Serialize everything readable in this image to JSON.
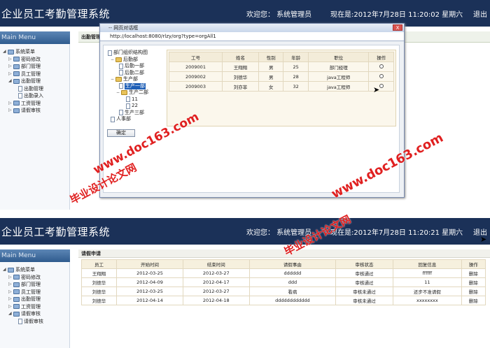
{
  "header": {
    "title": "企业员工考勤管理系统",
    "welcome": "欢迎您：  系统管理员",
    "time_top": "现在是:2012年7月28日  11:20:02 星期六",
    "time_bottom": "现在是:2012年7月28日  11:20:21 星期六",
    "logout": "退出"
  },
  "main_menu_label": "Main Menu",
  "sidebar_top": [
    "系统菜单",
    "密码修改",
    "部门管理",
    "员工管理",
    "出勤管理",
    "出勤管理",
    "出勤录入",
    "工资管理",
    "请假审核"
  ],
  "sidebar_bottom": [
    "系统菜单",
    "密码修改",
    "部门管理",
    "员工管理",
    "出勤管理",
    "工资管理",
    "请假审核",
    "请假审核"
  ],
  "content_top_tab": "出勤管理",
  "dialog": {
    "title": "-- 网页对话框",
    "url": "http://localhost:8080/rlzy/org?type=orgAll1",
    "close": "X",
    "confirm": "确定",
    "org_tree": [
      "部门组织结构图",
      "后勤部",
      "后勤一部",
      "后勤二部",
      "生产部",
      "生产一部",
      "生产二部",
      "11",
      "22",
      "生产三部",
      "人事部"
    ],
    "columns": [
      "工号",
      "姓名",
      "性别",
      "年龄",
      "职位",
      "操作"
    ],
    "rows": [
      [
        "2009001",
        "王翔翔",
        "男",
        "25",
        "部门经理"
      ],
      [
        "2009002",
        "刘德华",
        "男",
        "28",
        "java工程师"
      ],
      [
        "2009003",
        "刘亦菲",
        "女",
        "32",
        "java工程师"
      ]
    ]
  },
  "leave": {
    "panel_title": "请假申请",
    "columns": [
      "员工",
      "开始时间",
      "结束时间",
      "请假事由",
      "审核状态",
      "回复信息",
      "操作"
    ],
    "rows": [
      [
        "王翔翔",
        "2012-03-25",
        "2012-03-27",
        "dddddd",
        "审核通过",
        "ffffff",
        "删除"
      ],
      [
        "刘德华",
        "2012-04-09",
        "2012-04-17",
        "ddd",
        "审核通过",
        "11",
        "删除"
      ],
      [
        "刘德华",
        "2012-03-25",
        "2012-03-27",
        "看病",
        "审核未通过",
        "还步不准请假",
        "删除"
      ],
      [
        "刘德华",
        "2012-04-14",
        "2012-04-18",
        "dddddddddddd",
        "审核未通过",
        "xxxxxxxx",
        "删除"
      ]
    ]
  },
  "watermarks": {
    "site": "www.doc163.com",
    "brand": "毕业设计论文网"
  }
}
